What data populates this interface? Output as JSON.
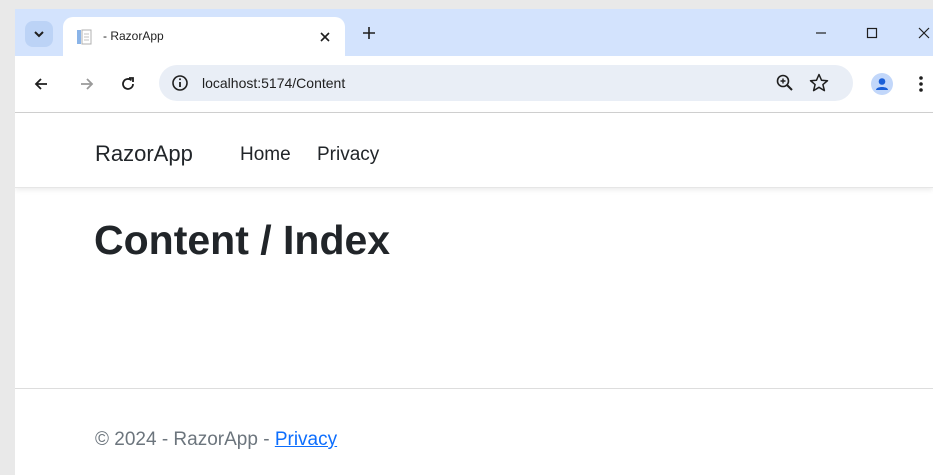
{
  "browser": {
    "tab": {
      "title": "- RazorApp"
    },
    "address_bar": {
      "url": "localhost:5174/Content"
    }
  },
  "page": {
    "brand": "RazorApp",
    "nav": [
      {
        "label": "Home"
      },
      {
        "label": "Privacy"
      }
    ],
    "heading": "Content / Index",
    "footer": {
      "text": "© 2024 - RazorApp - ",
      "link": "Privacy"
    }
  }
}
